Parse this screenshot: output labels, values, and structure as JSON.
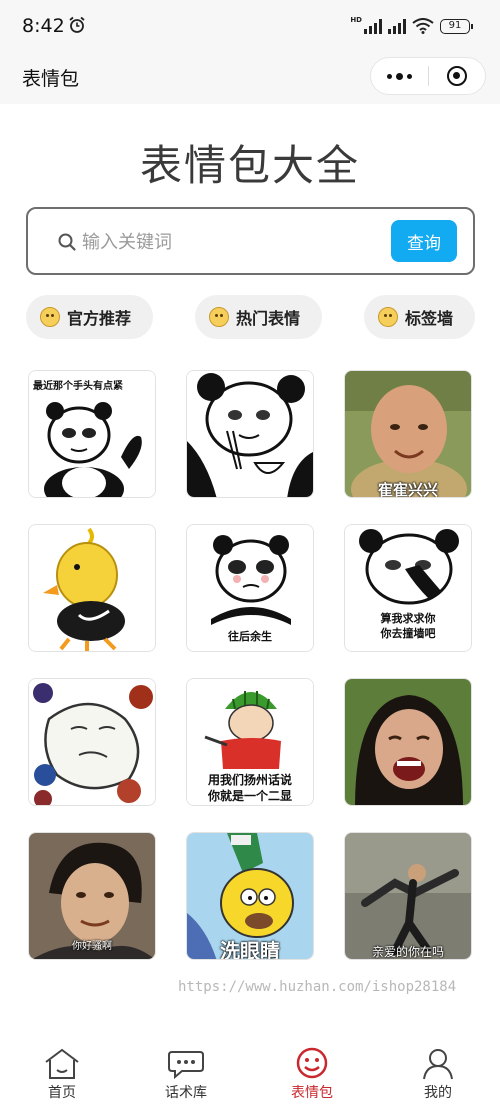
{
  "status_bar": {
    "time": "8:42",
    "network": "HD",
    "battery": "91"
  },
  "nav": {
    "title": "表情包"
  },
  "page": {
    "title": "表情包大全"
  },
  "search": {
    "placeholder": "输入关键词",
    "button": "查询"
  },
  "categories": [
    {
      "label": "官方推荐",
      "icon": "emoji-smile-icon"
    },
    {
      "label": "热门表情",
      "icon": "emoji-grin-icon"
    },
    {
      "label": "标签墙",
      "icon": "emoji-tag-icon"
    }
  ],
  "memes": [
    {
      "caption": "最近那个手头有点紧"
    },
    {
      "caption": ""
    },
    {
      "caption": "寉寉兴兴"
    },
    {
      "caption": ""
    },
    {
      "caption": "往后余生"
    },
    {
      "caption_line1": "算我求求你",
      "caption_line2": "你去撞墙吧"
    },
    {
      "caption": ""
    },
    {
      "caption_line1": "用我们扬州话说",
      "caption_line2": "你就是一个二显"
    },
    {
      "caption": ""
    },
    {
      "caption": "你好骚啊"
    },
    {
      "caption": "洗眼睛"
    },
    {
      "caption": "亲爱的你在吗"
    }
  ],
  "watermark": "https://www.huzhan.com/ishop28184",
  "tabbar": {
    "items": [
      {
        "label": "首页",
        "icon": "home-icon"
      },
      {
        "label": "话术库",
        "icon": "chat-bubble-icon"
      },
      {
        "label": "表情包",
        "icon": "smiley-icon",
        "active": true
      },
      {
        "label": "我的",
        "icon": "user-icon"
      }
    ],
    "active_color": "#c8282e"
  },
  "colors": {
    "accent": "#12aaf0",
    "tab_active": "#c8282e"
  }
}
